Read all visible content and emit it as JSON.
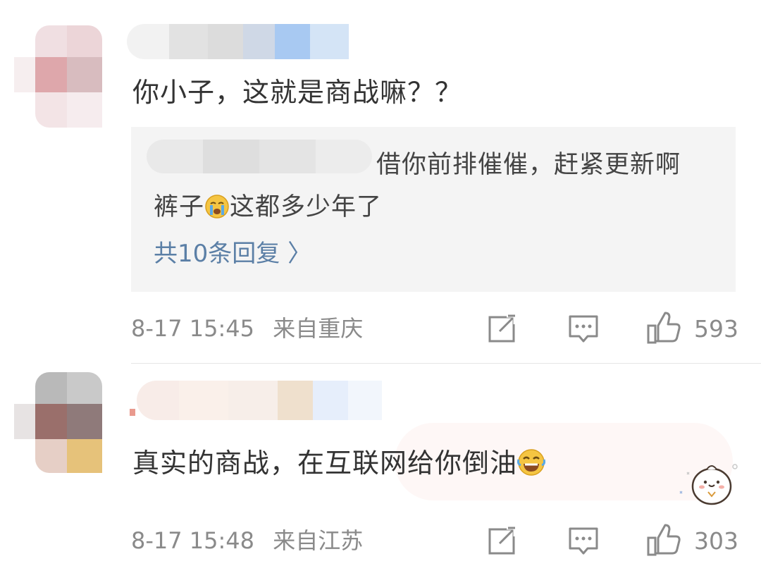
{
  "comments": [
    {
      "content": "你小子，这就是商战嘛？？",
      "reply_preview_line1": "借你前排催催，赶紧更新啊",
      "reply_preview_line2_a": "裤子",
      "reply_preview_line2_b": "这都多少年了",
      "reply_emoji": "crying-face",
      "replies_link": "共10条回复 〉",
      "date": "8-17",
      "time": "15:45",
      "location": "来自重庆",
      "likes": "593"
    },
    {
      "content": "真实的商战，在互联网给你倒油",
      "content_emoji": "laughing-tears-face",
      "badge": "cute-bun-sticker",
      "date": "8-17",
      "time": "15:48",
      "location": "来自江苏",
      "likes": "303"
    }
  ],
  "colors": {
    "text": "#333333",
    "meta": "#8a8a8a",
    "link": "#5b7fa6",
    "reply_bg": "#f4f4f4"
  }
}
